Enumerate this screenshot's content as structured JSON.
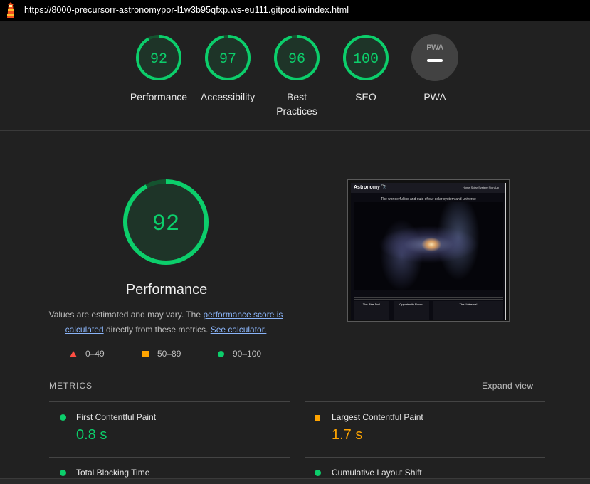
{
  "browser": {
    "url": "https://8000-precursorr-astronomypor-l1w3b95qfxp.ws-eu111.gitpod.io/index.html"
  },
  "gauges": [
    {
      "score": "92",
      "label": "Performance",
      "fraction": 0.92,
      "color": "#0cce6b"
    },
    {
      "score": "97",
      "label": "Accessibility",
      "fraction": 0.97,
      "color": "#0cce6b"
    },
    {
      "score": "96",
      "label_line1": "Best",
      "label_line2": "Practices",
      "fraction": 0.96,
      "color": "#0cce6b"
    },
    {
      "score": "100",
      "label": "SEO",
      "fraction": 1.0,
      "color": "#0cce6b"
    },
    {
      "badge": "PWA",
      "label": "PWA"
    }
  ],
  "performance": {
    "score": "92",
    "fraction": 0.92,
    "title": "Performance",
    "desc_text1": "Values are estimated and may vary. The ",
    "desc_link1": "performance score is calculated",
    "desc_text2": " directly from these metrics. ",
    "desc_link2": "See calculator."
  },
  "legend": {
    "fail": "0–49",
    "average": "50–89",
    "pass": "90–100"
  },
  "screenshot_thumb": {
    "brand": "Astronomy 🔭",
    "nav": "Home   Solar System   Sign-Up",
    "tagline": "The wonderful ins and outs of our solar system and universe",
    "card1": "The Blue Dot!",
    "card2": "Opportunity Rover!",
    "card3": "The Universe!"
  },
  "metrics": {
    "header": "METRICS",
    "expand_label": "Expand view",
    "fcp": {
      "title": "First Contentful Paint",
      "value": "0.8 s"
    },
    "lcp": {
      "title": "Largest Contentful Paint",
      "value": "1.7 s"
    },
    "tbt": {
      "title": "Total Blocking Time"
    },
    "cls": {
      "title": "Cumulative Layout Shift"
    }
  },
  "colors": {
    "pass": "#0cce6b",
    "average": "#ffa400",
    "fail": "#ff4e42",
    "link": "#8ab4f8"
  }
}
